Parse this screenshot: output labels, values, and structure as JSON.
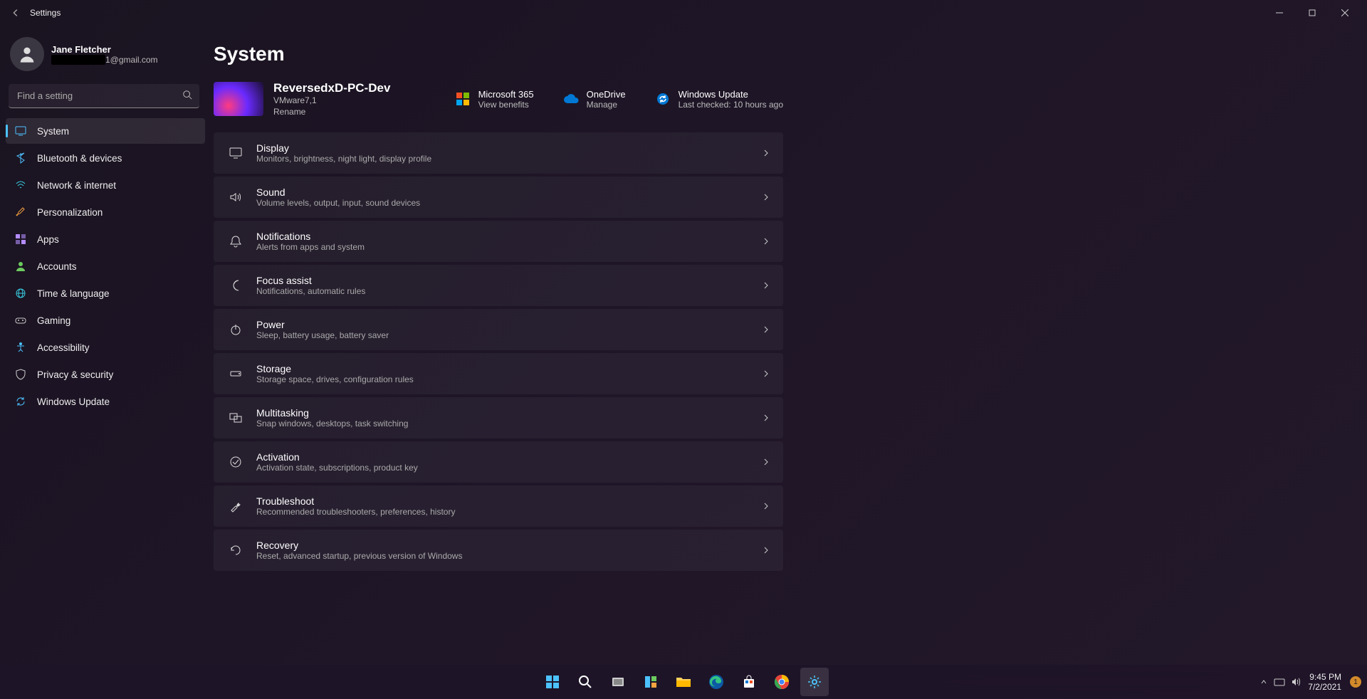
{
  "window": {
    "title": "Settings"
  },
  "user": {
    "name": "Jane Fletcher",
    "email_visible_suffix": "1@gmail.com"
  },
  "search": {
    "placeholder": "Find a setting"
  },
  "sidebar": {
    "items": [
      {
        "label": "System",
        "icon": "system",
        "active": true
      },
      {
        "label": "Bluetooth & devices",
        "icon": "bluetooth"
      },
      {
        "label": "Network & internet",
        "icon": "wifi"
      },
      {
        "label": "Personalization",
        "icon": "brush"
      },
      {
        "label": "Apps",
        "icon": "apps"
      },
      {
        "label": "Accounts",
        "icon": "person"
      },
      {
        "label": "Time & language",
        "icon": "globe"
      },
      {
        "label": "Gaming",
        "icon": "game"
      },
      {
        "label": "Accessibility",
        "icon": "access"
      },
      {
        "label": "Privacy & security",
        "icon": "shield"
      },
      {
        "label": "Windows Update",
        "icon": "update"
      }
    ]
  },
  "page": {
    "heading": "System",
    "pc": {
      "name": "ReversedxD-PC-Dev",
      "model": "VMware7,1",
      "rename": "Rename"
    },
    "quick": [
      {
        "title": "Microsoft 365",
        "sub": "View benefits",
        "icon": "ms365"
      },
      {
        "title": "OneDrive",
        "sub": "Manage",
        "icon": "onedrive"
      },
      {
        "title": "Windows Update",
        "sub": "Last checked: 10 hours ago",
        "icon": "update"
      }
    ],
    "rows": [
      {
        "title": "Display",
        "sub": "Monitors, brightness, night light, display profile",
        "icon": "display"
      },
      {
        "title": "Sound",
        "sub": "Volume levels, output, input, sound devices",
        "icon": "sound"
      },
      {
        "title": "Notifications",
        "sub": "Alerts from apps and system",
        "icon": "bell"
      },
      {
        "title": "Focus assist",
        "sub": "Notifications, automatic rules",
        "icon": "moon"
      },
      {
        "title": "Power",
        "sub": "Sleep, battery usage, battery saver",
        "icon": "power"
      },
      {
        "title": "Storage",
        "sub": "Storage space, drives, configuration rules",
        "icon": "drive"
      },
      {
        "title": "Multitasking",
        "sub": "Snap windows, desktops, task switching",
        "icon": "multi"
      },
      {
        "title": "Activation",
        "sub": "Activation state, subscriptions, product key",
        "icon": "check"
      },
      {
        "title": "Troubleshoot",
        "sub": "Recommended troubleshooters, preferences, history",
        "icon": "wrench"
      },
      {
        "title": "Recovery",
        "sub": "Reset, advanced startup, previous version of Windows",
        "icon": "recover"
      }
    ]
  },
  "taskbar": {
    "time": "9:45 PM",
    "date": "7/2/2021",
    "notif_count": "1"
  }
}
